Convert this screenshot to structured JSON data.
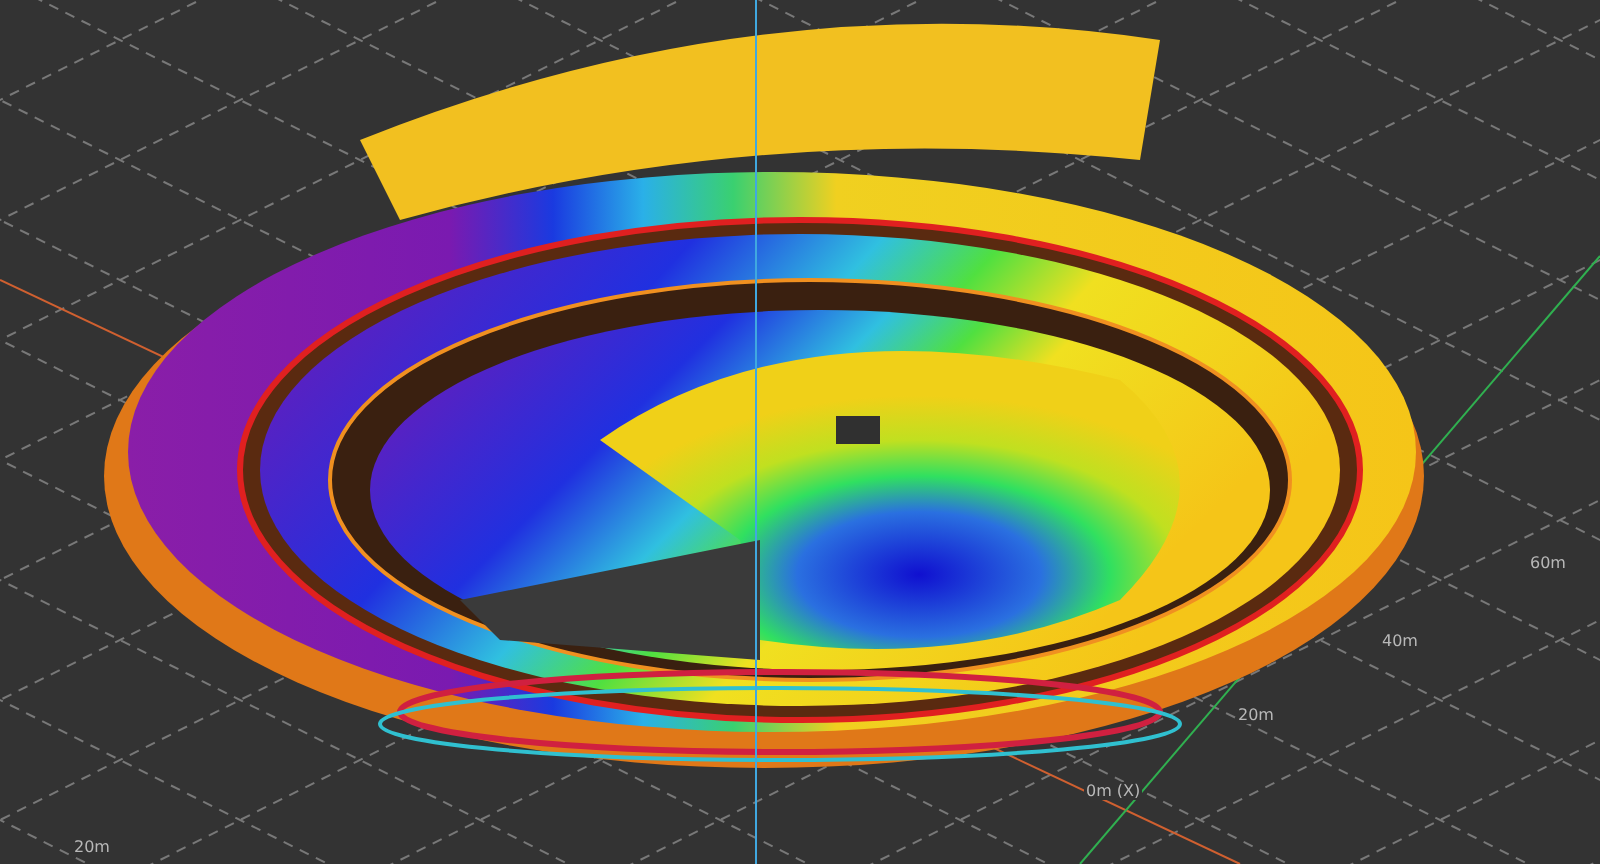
{
  "viewport": {
    "axis_labels": [
      {
        "text": "60m"
      },
      {
        "text": "40m"
      },
      {
        "text": "20m"
      },
      {
        "text": "0m (X)"
      },
      {
        "text": "20m"
      }
    ]
  }
}
